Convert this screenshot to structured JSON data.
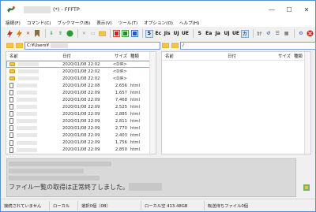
{
  "window": {
    "title_suffix": "(*) - FFFTP"
  },
  "menu": [
    "接続(F)",
    "コマンド(C)",
    "ブックマーク(B)",
    "表示(V)",
    "ツール(T)",
    "オプション(O)",
    "ヘルプ(H)"
  ],
  "toolbar": {
    "labels": [
      "S",
      "Ec",
      "Jis",
      "UJ",
      "UE",
      "S",
      "Ea",
      "Ja",
      "UJ",
      "UE"
    ]
  },
  "local": {
    "path": "C:¥Users¥",
    "columns": {
      "name": "名前",
      "date": "日付",
      "size": "サイズ",
      "type": "種類"
    },
    "rows": [
      {
        "icon": "folder",
        "date": "2020/01/08 22:02",
        "size": "<DIR>",
        "type": ""
      },
      {
        "icon": "folder",
        "date": "2020/01/08 22:02",
        "size": "<DIR>",
        "type": ""
      },
      {
        "icon": "folder",
        "date": "2020/01/08 22:02",
        "size": "<DIR>",
        "type": ""
      },
      {
        "icon": "file",
        "date": "2020/01/08 22:08",
        "size": "2,656",
        "type": "html"
      },
      {
        "icon": "file",
        "date": "2020/01/08 22:09",
        "size": "1,657",
        "type": "html"
      },
      {
        "icon": "file",
        "date": "2020/01/08 22:09",
        "size": "7,468",
        "type": "html"
      },
      {
        "icon": "file",
        "date": "2020/01/08 22:09",
        "size": "2,525",
        "type": "html"
      },
      {
        "icon": "file",
        "date": "2020/01/08 22:09",
        "size": "2,885",
        "type": "html"
      },
      {
        "icon": "file",
        "date": "2020/01/08 22:09",
        "size": "2,811",
        "type": "html"
      },
      {
        "icon": "file",
        "date": "2020/01/08 22:09",
        "size": "2,770",
        "type": "html"
      },
      {
        "icon": "file",
        "date": "2020/01/08 22:09",
        "size": "2,403",
        "type": "html"
      },
      {
        "icon": "file",
        "date": "2020/01/08 22:09",
        "size": "1,756",
        "type": "html"
      },
      {
        "icon": "file",
        "date": "2020/01/08 22:09",
        "size": "2,850",
        "type": "html"
      }
    ]
  },
  "remote": {
    "path": "/",
    "columns": {
      "name": "名前",
      "date": "日付",
      "size": "サイズ",
      "type": "種類"
    }
  },
  "log": {
    "message": "ファイル一覧の取得は正常終了しました。"
  },
  "status": {
    "connection": "接続されていません",
    "local_label": "ローカル",
    "selected": "選択0個（0B）",
    "local_free": "ローカル空 413.48GB",
    "transfer": "転送待ちファイル0個"
  }
}
